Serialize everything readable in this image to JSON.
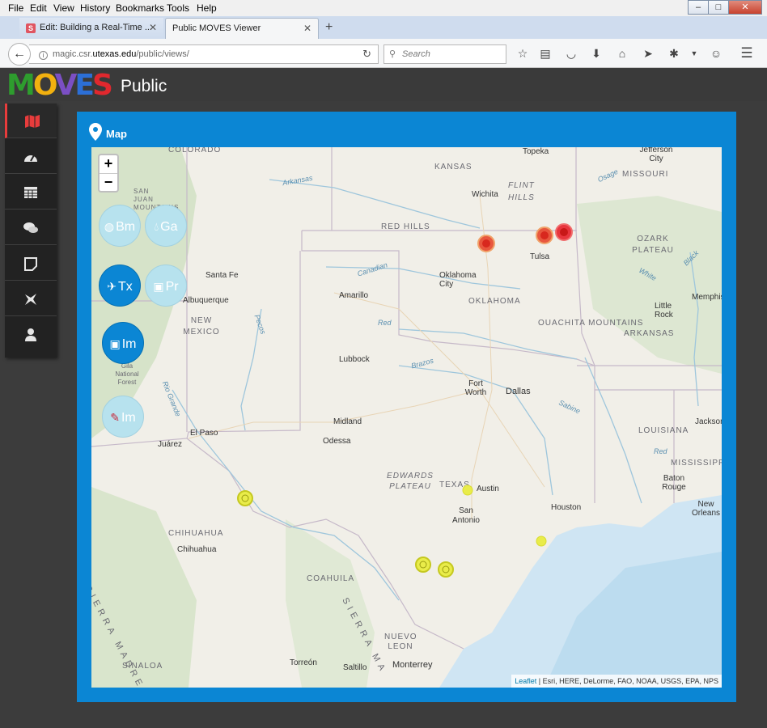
{
  "browser": {
    "menu": [
      "File",
      "Edit",
      "View",
      "History",
      "Bookmarks",
      "Tools",
      "Help"
    ],
    "tabs": [
      {
        "title": "Edit: Building a Real-Time ...",
        "favicon": "S"
      },
      {
        "title": "Public MOVES Viewer"
      }
    ],
    "url_prefix": "magic.csr.",
    "url_host": "utexas.edu",
    "url_path": "/public/views/",
    "search_placeholder": "Search"
  },
  "app": {
    "logo_letters": [
      {
        "ch": "M",
        "color": "#2e9d2e"
      },
      {
        "ch": "O",
        "color": "#f2b10f"
      },
      {
        "ch": "V",
        "color": "#7b4fc4"
      },
      {
        "ch": "E",
        "color": "#2c6fd6"
      },
      {
        "ch": "S",
        "color": "#e0282e"
      }
    ],
    "title": "Public"
  },
  "sidebar": [
    {
      "icon": "map-icon",
      "active": true
    },
    {
      "icon": "dashboard-icon"
    },
    {
      "icon": "table-icon"
    },
    {
      "icon": "chat-icon"
    },
    {
      "icon": "note-icon"
    },
    {
      "icon": "plugin-icon"
    },
    {
      "icon": "user-icon"
    }
  ],
  "panel": {
    "title": "Map"
  },
  "map": {
    "zoom_in": "+",
    "zoom_out": "−",
    "layers": [
      {
        "label": "Bm",
        "icon": "globe-icon",
        "style": "light"
      },
      {
        "label": "Ga",
        "icon": "drop-icon",
        "style": "light"
      },
      {
        "label": "Tx",
        "icon": "plane-icon",
        "style": "dark"
      },
      {
        "label": "Pr",
        "icon": "image-icon",
        "style": "light"
      },
      {
        "label": "Im",
        "icon": "image-icon",
        "style": "dark"
      },
      {
        "label": "Im",
        "icon": "edit-icon",
        "style": "light"
      }
    ],
    "labels": {
      "regions": [
        "COLORADO",
        "KANSAS",
        "MISSOURI",
        "FLINT HILLS",
        "RED HILLS",
        "OZARK PLATEAU",
        "OKLAHOMA",
        "OUACHITA MOUNTAINS",
        "ARKANSAS",
        "NEW MEXICO",
        "LOUISIANA",
        "MISSISSIPPI",
        "TEXAS",
        "EDWARDS PLATEAU",
        "CHIHUAHUA",
        "COAHUILA",
        "NUEVO LEON",
        "SINALOA",
        "SIERRA MADRE OC",
        "SIERRA MA",
        "SAN JUAN MOUNTAINS",
        "Gila National Forest"
      ],
      "cities": [
        "Topeka",
        "Jefferson City",
        "Wichita",
        "Tulsa",
        "Oklahoma City",
        "Santa Fe",
        "Amarillo",
        "Albuquerque",
        "Little Rock",
        "Memphis",
        "Lubbock",
        "Fort Worth",
        "Dallas",
        "Midland",
        "Odessa",
        "El Paso",
        "Juárez",
        "Jackson",
        "Austin",
        "Baton Rouge",
        "Houston",
        "San Antonio",
        "New Orleans",
        "Chihuahua",
        "Torreón",
        "Saltillo",
        "Monterrey"
      ],
      "rivers": [
        "Arkansas",
        "Osage",
        "Canadian",
        "Red",
        "Brazos",
        "Sabine",
        "Pecos",
        "Rio Grande",
        "White",
        "Black",
        "Red"
      ]
    },
    "markers": {
      "red": [
        "Oklahoma 1",
        "Oklahoma 2",
        "Oklahoma 3"
      ],
      "yellow": [
        "Texas 1",
        "Texas 2",
        "Texas 3",
        "Texas 4",
        "Texas 5"
      ]
    },
    "attribution_link": "Leaflet",
    "attribution_text": " | Esri, HERE, DeLorme, FAO, NOAA, USGS, EPA, NPS"
  }
}
